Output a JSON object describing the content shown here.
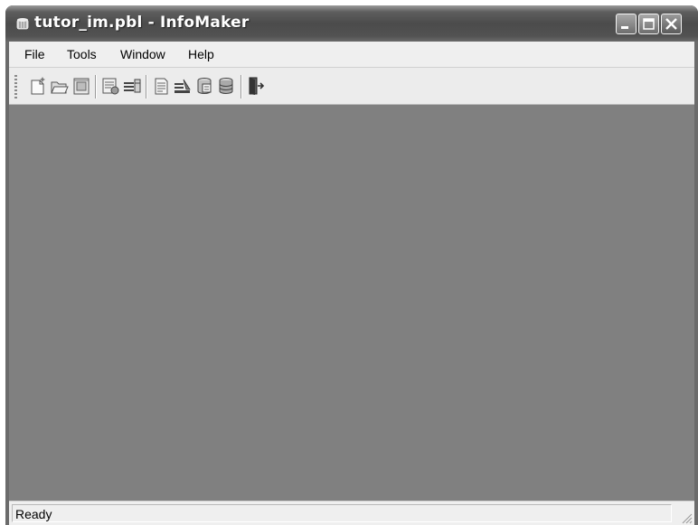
{
  "window": {
    "title": "tutor_im.pbl - InfoMaker"
  },
  "menu": {
    "items": [
      {
        "label": "File"
      },
      {
        "label": "Tools"
      },
      {
        "label": "Window"
      },
      {
        "label": "Help"
      }
    ]
  },
  "toolbar": {
    "buttons": [
      {
        "icon": "new-icon"
      },
      {
        "icon": "open-icon"
      },
      {
        "icon": "inherit-icon"
      },
      {
        "icon": "report-icon"
      },
      {
        "icon": "form-icon"
      },
      {
        "icon": "query-icon"
      },
      {
        "icon": "pipeline-icon"
      },
      {
        "icon": "database-painter-icon"
      },
      {
        "icon": "database-icon"
      },
      {
        "icon": "exit-icon"
      }
    ]
  },
  "status": {
    "text": "Ready"
  }
}
